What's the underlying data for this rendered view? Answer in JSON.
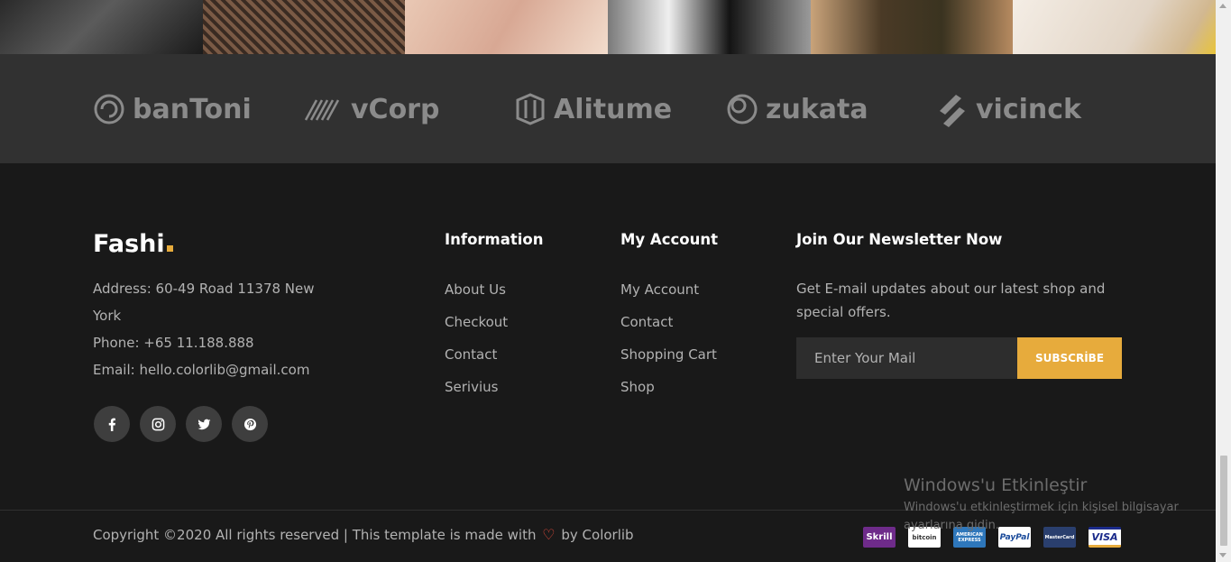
{
  "partners": [
    {
      "name": "banToni",
      "icon": "bantoni-logo-icon"
    },
    {
      "name": "vCorp",
      "icon": "vcorp-logo-icon"
    },
    {
      "name": "Alitume",
      "icon": "alitume-logo-icon"
    },
    {
      "name": "zukata",
      "icon": "zukata-logo-icon"
    },
    {
      "name": "vicinck",
      "icon": "vicinck-logo-icon"
    }
  ],
  "footer": {
    "brand": "Fashi",
    "brand_accent_color": "#e7ab3c",
    "address_line1": "Address: 60-49 Road 11378 New",
    "address_line2": "York",
    "phone": "Phone: +65 11.188.888",
    "email": "Email: hello.colorlib@gmail.com",
    "social": [
      {
        "name": "facebook-icon"
      },
      {
        "name": "instagram-icon"
      },
      {
        "name": "twitter-icon"
      },
      {
        "name": "pinterest-icon"
      }
    ],
    "information": {
      "title": "Information",
      "links": [
        "About Us",
        "Checkout",
        "Contact",
        "Serivius"
      ]
    },
    "my_account": {
      "title": "My Account",
      "links": [
        "My Account",
        "Contact",
        "Shopping Cart",
        "Shop"
      ]
    },
    "newsletter": {
      "title": "Join Our Newsletter Now",
      "text": "Get E-mail updates about our latest shop and special offers.",
      "placeholder": "Enter Your Mail",
      "button": "SUBSCRİBE"
    },
    "copyright_before": "Copyright ©2020 All rights reserved | This template is made with",
    "copyright_after": "by Colorlib",
    "payments": [
      {
        "label": "Skrill",
        "icon": "skrill-icon"
      },
      {
        "label": "bitcoin",
        "icon": "bitcoin-icon"
      },
      {
        "label": "AMERICAN EXPRESS",
        "icon": "amex-icon"
      },
      {
        "label": "PayPal",
        "icon": "paypal-icon"
      },
      {
        "label": "MasterCard",
        "icon": "mastercard-icon"
      },
      {
        "label": "VISA",
        "icon": "visa-icon"
      }
    ]
  },
  "windows_watermark": {
    "title": "Windows'u Etkinleştir",
    "subtitle": "Windows'u etkinleştirmek için kişisel bilgisayar ayarlarına gidin."
  }
}
